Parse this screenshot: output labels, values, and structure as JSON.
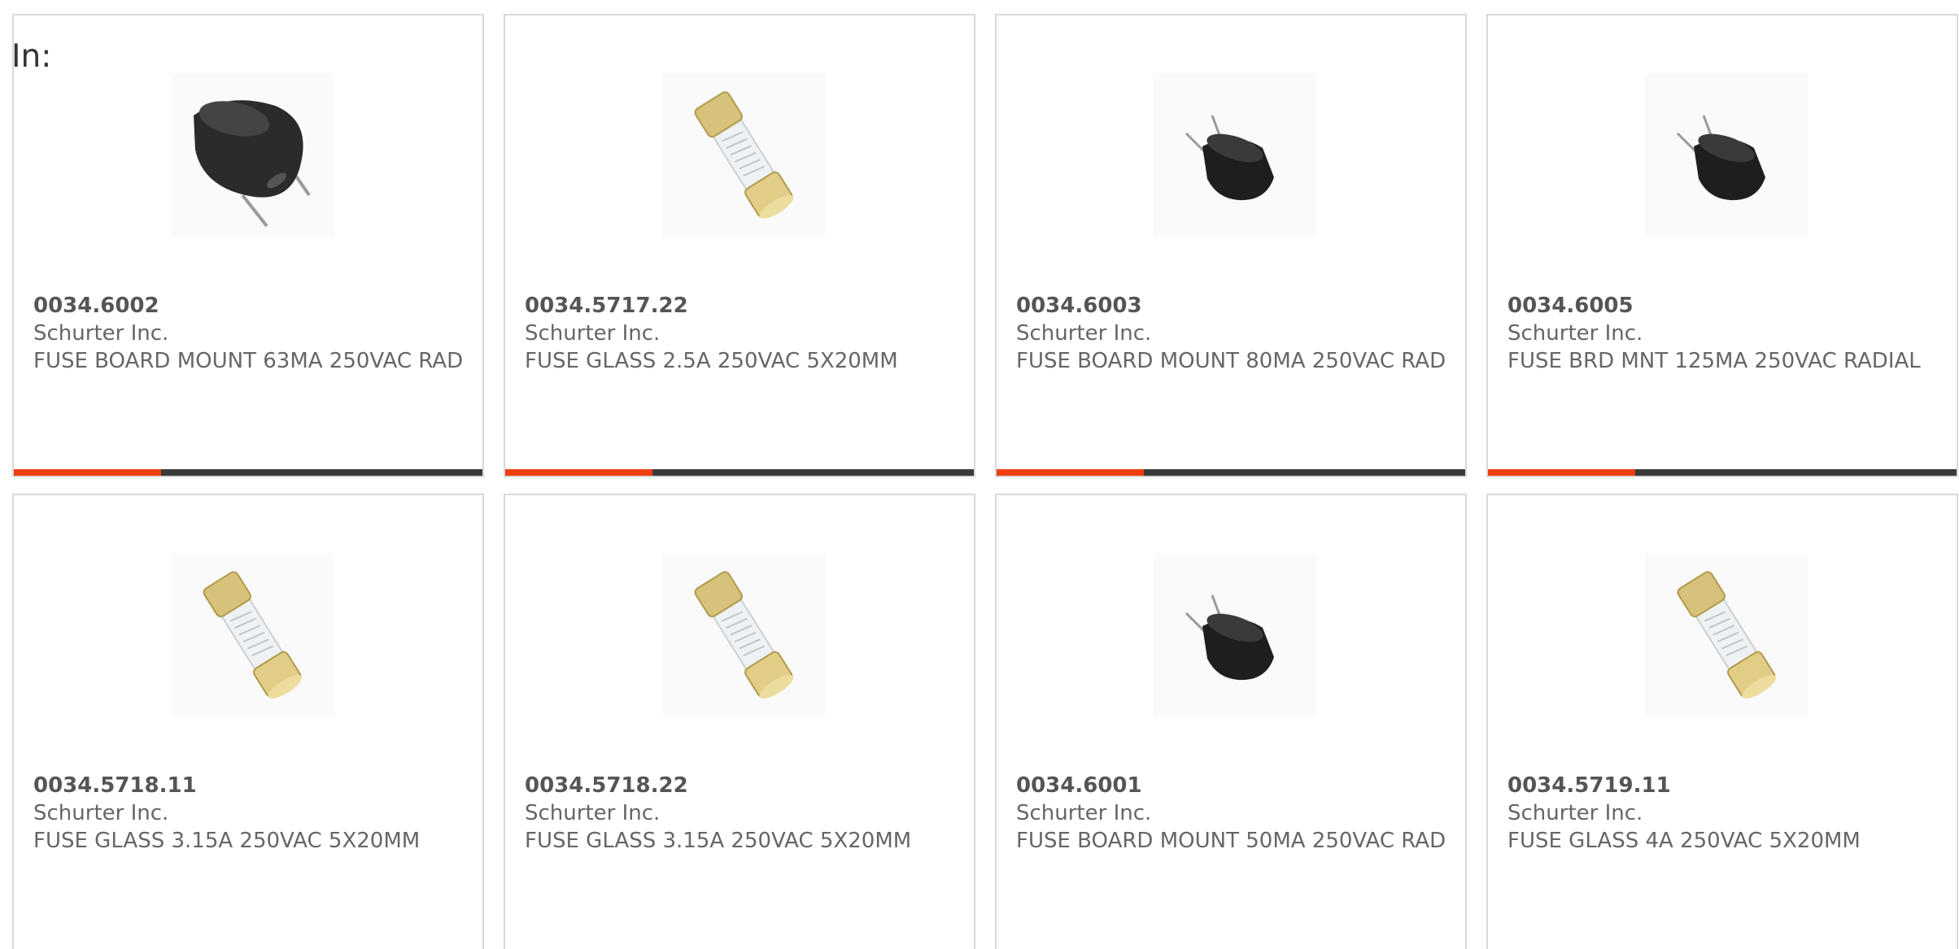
{
  "filter_label": "In:",
  "colors": {
    "accent": "#ef3e0f",
    "bar": "#3a3a3a",
    "border": "#d9d9d9"
  },
  "products": [
    {
      "part": "0034.6002",
      "manufacturer": "Schurter Inc.",
      "description": "FUSE BOARD MOUNT 63MA 250VAC RAD",
      "image": "radial-large-fuse-icon",
      "highlighted": true
    },
    {
      "part": "0034.5717.22",
      "manufacturer": "Schurter Inc.",
      "description": "FUSE GLASS 2.5A 250VAC 5X20MM",
      "image": "glass-fuse-icon",
      "highlighted": true
    },
    {
      "part": "0034.6003",
      "manufacturer": "Schurter Inc.",
      "description": "FUSE BOARD MOUNT 80MA 250VAC RAD",
      "image": "radial-small-fuse-icon",
      "highlighted": true
    },
    {
      "part": "0034.6005",
      "manufacturer": "Schurter Inc.",
      "description": "FUSE BRD MNT 125MA 250VAC RADIAL",
      "image": "radial-small-fuse-icon",
      "highlighted": true
    },
    {
      "part": "0034.5718.11",
      "manufacturer": "Schurter Inc.",
      "description": "FUSE GLASS 3.15A 250VAC 5X20MM",
      "image": "glass-fuse-icon",
      "highlighted": false
    },
    {
      "part": "0034.5718.22",
      "manufacturer": "Schurter Inc.",
      "description": "FUSE GLASS 3.15A 250VAC 5X20MM",
      "image": "glass-fuse-icon",
      "highlighted": false
    },
    {
      "part": "0034.6001",
      "manufacturer": "Schurter Inc.",
      "description": "FUSE BOARD MOUNT 50MA 250VAC RAD",
      "image": "radial-small-fuse-icon",
      "highlighted": false
    },
    {
      "part": "0034.5719.11",
      "manufacturer": "Schurter Inc.",
      "description": "FUSE GLASS 4A 250VAC 5X20MM",
      "image": "glass-fuse-icon",
      "highlighted": false
    }
  ]
}
